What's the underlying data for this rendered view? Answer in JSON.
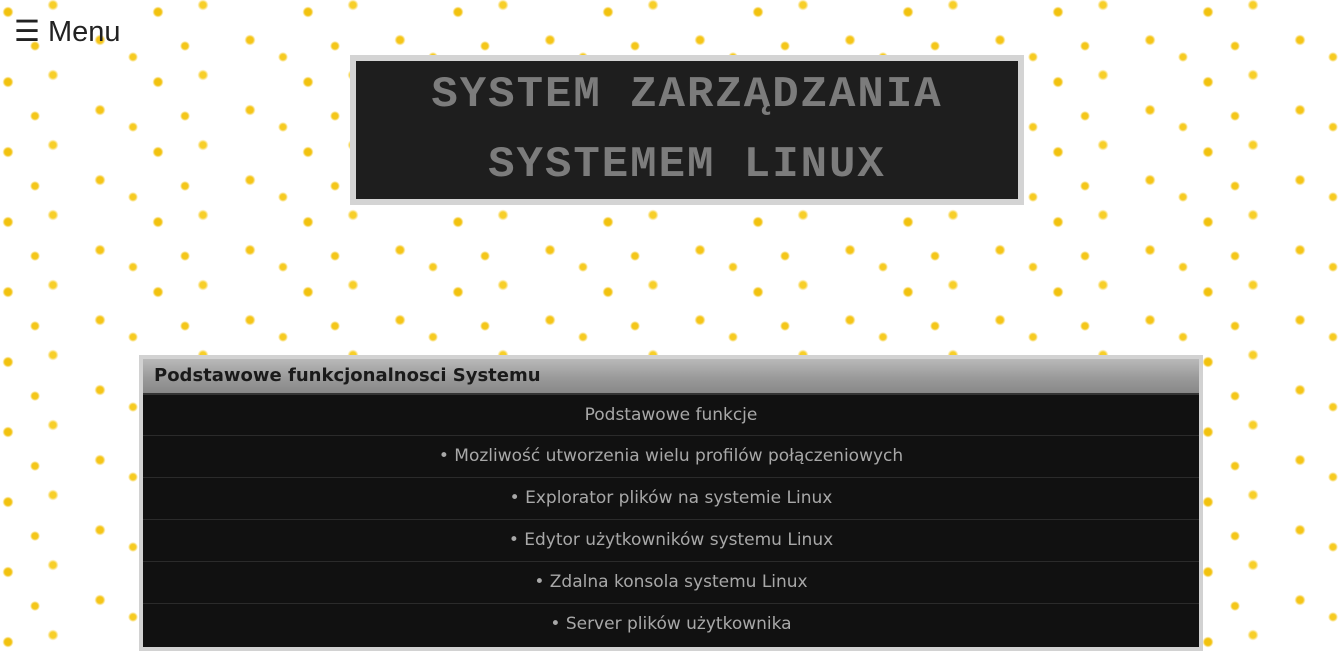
{
  "menu": {
    "icon": "hamburger-icon",
    "icon_glyph": "☰",
    "label": "Menu"
  },
  "title": {
    "line1": "SYSTEM ZARZĄDZANIA",
    "line2": "SYSTEMEM LINUX"
  },
  "features_panel": {
    "header": "Podstawowe funkcjonalnosci Systemu",
    "subheader": "Podstawowe funkcje",
    "items": [
      "• Mozliwość utworzenia wielu profilów połączeniowych",
      "• Explorator plików na systemie Linux",
      "• Edytor użytkowników systemu Linux",
      "• Zdalna konsola systemu Linux",
      "• Server plików użytkownika"
    ]
  },
  "colors": {
    "background": "#ffffff",
    "dots": "#f5c518",
    "title_bg": "#1e1e1e",
    "title_text": "#7c7c7c",
    "panel_bg": "#111111",
    "panel_text": "#a8a8a8",
    "panel_border": "#d2d2d2"
  }
}
